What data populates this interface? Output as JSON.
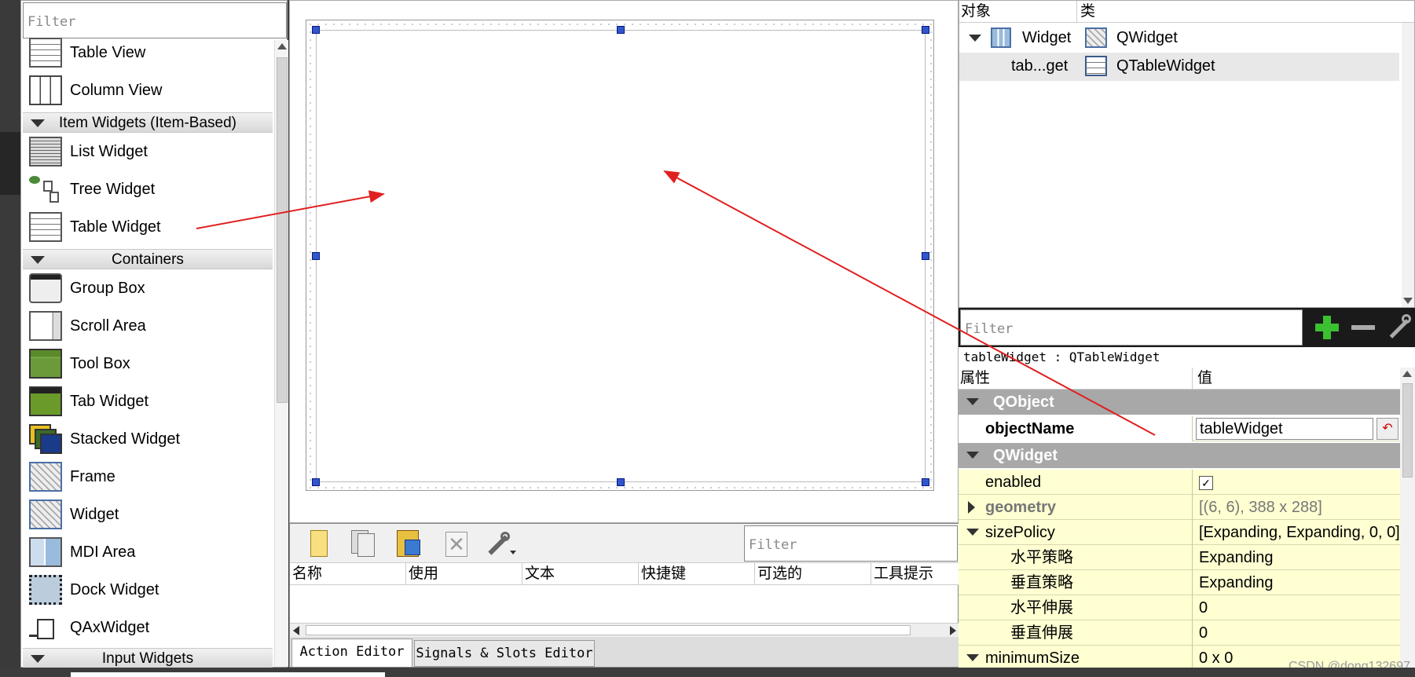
{
  "widget_box": {
    "filter_placeholder": "Filter",
    "items_top": [
      {
        "label": "Table View",
        "icon": "table-view-icon"
      },
      {
        "label": "Column View",
        "icon": "column-view-icon"
      }
    ],
    "categories": {
      "item_widgets": "Item Widgets (Item-Based)",
      "containers": "Containers",
      "input_widgets": "Input Widgets"
    },
    "item_widgets": [
      {
        "label": "List Widget",
        "icon": "list-widget-icon"
      },
      {
        "label": "Tree Widget",
        "icon": "tree-widget-icon"
      },
      {
        "label": "Table Widget",
        "icon": "table-widget-icon"
      }
    ],
    "containers": [
      {
        "label": "Group Box",
        "icon": "group-box-icon"
      },
      {
        "label": "Scroll Area",
        "icon": "scroll-area-icon"
      },
      {
        "label": "Tool Box",
        "icon": "tool-box-icon"
      },
      {
        "label": "Tab Widget",
        "icon": "tab-widget-icon"
      },
      {
        "label": "Stacked Widget",
        "icon": "stacked-widget-icon"
      },
      {
        "label": "Frame",
        "icon": "frame-icon"
      },
      {
        "label": "Widget",
        "icon": "widget-icon"
      },
      {
        "label": "MDI Area",
        "icon": "mdi-area-icon"
      },
      {
        "label": "Dock Widget",
        "icon": "dock-widget-icon"
      },
      {
        "label": "QAxWidget",
        "icon": "qaxwidget-icon"
      }
    ]
  },
  "action_editor": {
    "filter_placeholder": "Filter",
    "columns": [
      "名称",
      "使用",
      "文本",
      "快捷键",
      "可选的",
      "工具提示"
    ],
    "tabs": [
      "Action Editor",
      "Signals & Slots Editor"
    ]
  },
  "object_inspector": {
    "columns": [
      "对象",
      "类"
    ],
    "rows": [
      {
        "object": "Widget",
        "class": "QWidget"
      },
      {
        "object": "tab...get",
        "class": "QTableWidget"
      }
    ]
  },
  "property_editor": {
    "filter_placeholder": "Filter",
    "title": "tableWidget : QTableWidget",
    "columns": [
      "属性",
      "值"
    ],
    "groups": {
      "qobject": "QObject",
      "qwidget": "QWidget"
    },
    "object_name": {
      "key": "objectName",
      "value": "tableWidget"
    },
    "rows": {
      "enabled": {
        "key": "enabled",
        "value": "✓"
      },
      "geometry": {
        "key": "geometry",
        "value": "[(6, 6), 388 x 288]"
      },
      "size_policy": {
        "key": "sizePolicy",
        "value": "[Expanding, Expanding, 0, 0]"
      },
      "h_policy": {
        "key": "水平策略",
        "value": "Expanding"
      },
      "v_policy": {
        "key": "垂直策略",
        "value": "Expanding"
      },
      "h_stretch": {
        "key": "水平伸展",
        "value": "0"
      },
      "v_stretch": {
        "key": "垂直伸展",
        "value": "0"
      },
      "minimum_size": {
        "key": "minimumSize",
        "value": "0 x 0"
      }
    }
  },
  "watermark": "CSDN @dong132697",
  "colors": {
    "annotation_arrow": "#e02020",
    "group_header": "#a8a8a8",
    "property_row": "#ffffd2",
    "selection_handle": "#3355cc"
  }
}
